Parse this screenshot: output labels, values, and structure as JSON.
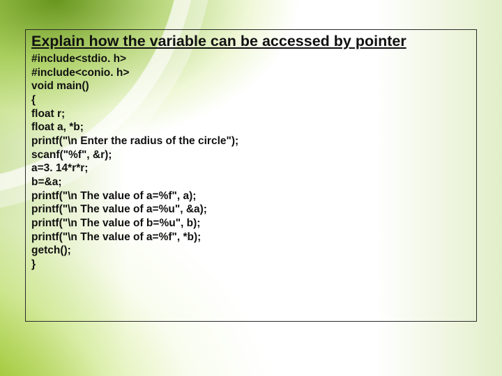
{
  "slide": {
    "title": "Explain how the variable can be accessed by pointer",
    "code": {
      "l1": "#include<stdio. h>",
      "l2": "#include<conio. h>",
      "l3": "void main()",
      "l4": "{",
      "l5": "float r;",
      "l6": "float a, *b;",
      "l7": "printf(\"\\n Enter the radius of the circle\");",
      "l8": "scanf(\"%f\", &r);",
      "l9": "a=3. 14*r*r;",
      "l10": "b=&a;",
      "l11": "printf(\"\\n The value of a=%f\", a);",
      "l12": "printf(\"\\n The value of a=%u\", &a);",
      "l13": "printf(\"\\n The value of b=%u\", b);",
      "l14": "printf(\"\\n The value of a=%f\", *b);",
      "l15": "getch();",
      "l16": "}"
    }
  }
}
